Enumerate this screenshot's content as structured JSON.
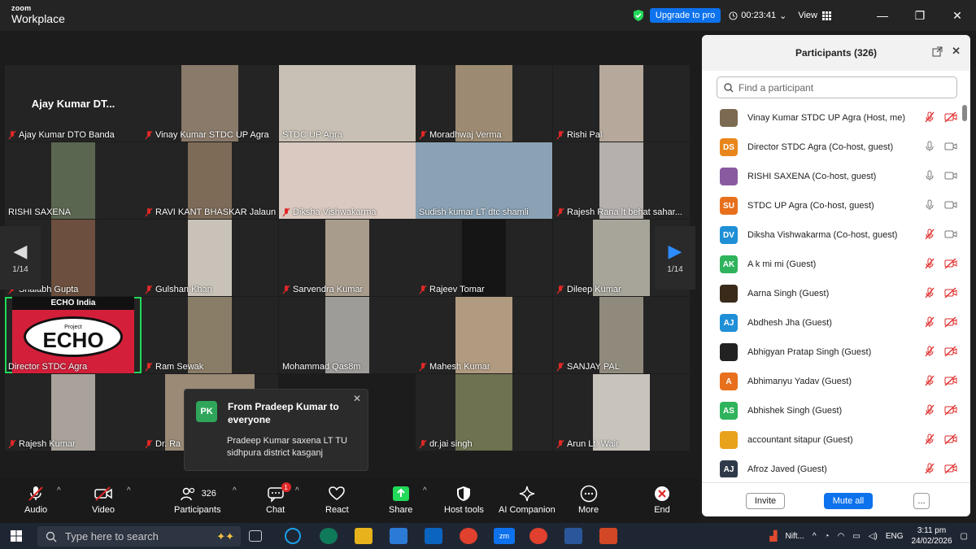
{
  "app": {
    "brand_small": "zoom",
    "brand_large": "Workplace"
  },
  "topbar": {
    "upgrade_label": "Upgrade to pro",
    "timer": "00:23:41",
    "view_label": "View"
  },
  "grid": {
    "page_indicator": "1/14",
    "tiles": [
      {
        "name": "Ajay Kumar DTO Banda",
        "big": "Ajay Kumar DT...",
        "video": false
      },
      {
        "name": "Vinay Kumar STDC UP Agra",
        "video": true,
        "color": "#8a7a6a"
      },
      {
        "name": "STDC UP Agra",
        "video": true,
        "color": "#c8c0b4",
        "nomic": true
      },
      {
        "name": "Moradhwaj Verma",
        "video": true,
        "color": "#9c8a72"
      },
      {
        "name": "Rishi Pal",
        "video": true,
        "color": "#b6a89a"
      },
      {
        "name": "RISHI SAXENA",
        "video": true,
        "color": "#5a6650",
        "nomic": true
      },
      {
        "name": "RAVI KANT BHASKAR Jalaun",
        "video": true,
        "color": "#7d6b58"
      },
      {
        "name": "Diksha Vishwakarma",
        "video": true,
        "color": "#d9c9c0"
      },
      {
        "name": "Sudish kumar LT dtc shamli",
        "video": true,
        "color": "#8aa2b4",
        "nomic": true
      },
      {
        "name": "Rajesh Rana lt behat sahar...",
        "video": true,
        "color": "#b5b0ad"
      },
      {
        "name": "Shalabh Gupta",
        "video": true,
        "color": "#6c4f3e"
      },
      {
        "name": "Gulshan Khan",
        "video": true,
        "color": "#c8c2b8"
      },
      {
        "name": "Sarvendra Kumar",
        "video": true,
        "color": "#a89c8c"
      },
      {
        "name": "Rajeev Tomar",
        "video": true,
        "color": "#151515"
      },
      {
        "name": "Dileep Kumar",
        "video": true,
        "color": "#a7a59a"
      },
      {
        "name": "Director STDC Agra",
        "video": true,
        "color": "#d41f3a",
        "nomic": true,
        "echo": true
      },
      {
        "name": "Ram Sewak",
        "video": true,
        "color": "#8a7d68"
      },
      {
        "name": "Mohammad Qas8m",
        "video": true,
        "color": "#9e9c98",
        "nomic": true
      },
      {
        "name": "Mahesh Kumar",
        "video": true,
        "color": "#b09a80"
      },
      {
        "name": "SANJAY PAL",
        "video": true,
        "color": "#8f8a7c"
      },
      {
        "name": "Rajesh Kumar",
        "video": true,
        "color": "#a8a29a"
      },
      {
        "name": "Dr. Ra",
        "video": true,
        "color": "#9a8a76"
      },
      {
        "name": "",
        "video": false
      },
      {
        "name": "dr.jai singh",
        "video": true,
        "color": "#6e7250"
      },
      {
        "name": "Arun Lt. Wair",
        "video": true,
        "color": "#c8c4bc"
      }
    ]
  },
  "echo": {
    "india": "ECHO India",
    "project": "Project",
    "logo": "ECHO"
  },
  "chat_popup": {
    "initials": "PK",
    "from": "From Pradeep Kumar to everyone",
    "message": "Pradeep Kumar saxena LT TU sidhpura district  kasganj"
  },
  "toolbar": {
    "audio": "Audio",
    "video": "Video",
    "participants": "Participants",
    "participants_count": "326",
    "chat": "Chat",
    "chat_badge": "1",
    "react": "React",
    "share": "Share",
    "host_tools": "Host tools",
    "ai_companion": "AI Companion",
    "more": "More",
    "end": "End"
  },
  "participants_panel": {
    "title": "Participants (326)",
    "search_placeholder": "Find a participant",
    "invite": "Invite",
    "mute_all": "Mute all",
    "more": "...",
    "rows": [
      {
        "initials": "",
        "name": "Vinay Kumar STDC UP Agra (Host, me)",
        "color": "#7c6a52",
        "photo": true,
        "muted": true,
        "cam_off": true
      },
      {
        "initials": "DS",
        "name": "Director STDC Agra (Co-host, guest)",
        "color": "#e8861c",
        "muted": false,
        "cam_off": false
      },
      {
        "initials": "",
        "name": "RISHI SAXENA (Co-host, guest)",
        "color": "#8a5aa0",
        "photo": true,
        "muted": false,
        "cam_off": false
      },
      {
        "initials": "SU",
        "name": "STDC UP Agra (Co-host, guest)",
        "color": "#e8701c",
        "muted": false,
        "cam_off": false
      },
      {
        "initials": "DV",
        "name": "Diksha Vishwakarma (Co-host, guest)",
        "color": "#1f8fd6",
        "muted": true,
        "cam_off": false
      },
      {
        "initials": "AK",
        "name": "A k mi mi (Guest)",
        "color": "#2fb35c",
        "muted": true,
        "cam_off": true
      },
      {
        "initials": "",
        "name": "Aarna Singh (Guest)",
        "color": "#3a2a1a",
        "photo": true,
        "muted": true,
        "cam_off": true
      },
      {
        "initials": "AJ",
        "name": "Abdhesh Jha (Guest)",
        "color": "#1f8fd6",
        "muted": true,
        "cam_off": true
      },
      {
        "initials": "",
        "name": "Abhigyan Pratap Singh (Guest)",
        "color": "#222",
        "photo": true,
        "muted": true,
        "cam_off": true
      },
      {
        "initials": "A",
        "name": "Abhimanyu Yadav (Guest)",
        "color": "#e8701c",
        "muted": true,
        "cam_off": true
      },
      {
        "initials": "AS",
        "name": "Abhishek Singh (Guest)",
        "color": "#2fb35c",
        "muted": true,
        "cam_off": true
      },
      {
        "initials": "",
        "name": "accountant sitapur (Guest)",
        "color": "#e8a21c",
        "photo": true,
        "muted": true,
        "cam_off": true
      },
      {
        "initials": "AJ",
        "name": "Afroz Javed (Guest)",
        "color": "#2e3a4a",
        "muted": true,
        "cam_off": true
      }
    ]
  },
  "taskbar": {
    "search_placeholder": "Type here to search",
    "stock": "Nift...",
    "lang": "ENG",
    "time": "3:11 pm",
    "date": "24/02/2026"
  }
}
